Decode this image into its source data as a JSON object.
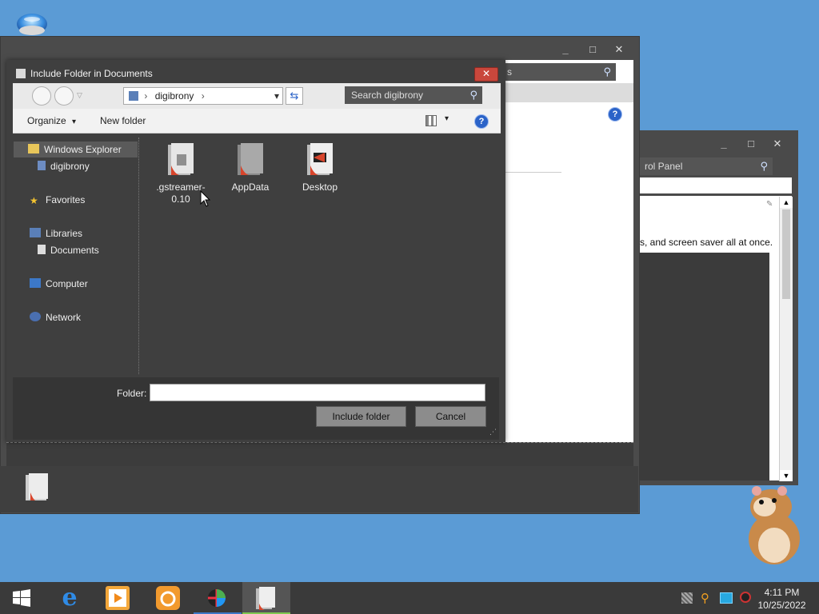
{
  "desktop": {
    "top_icon": "sphere-orb-icon"
  },
  "back_window": {
    "search_partial": "rol Panel",
    "description_partial": "s, and screen saver all at once.",
    "controls": [
      "_",
      "□",
      "✕"
    ]
  },
  "main_window": {
    "search_partial": "s",
    "controls": [
      "_",
      "□",
      "✕"
    ]
  },
  "dialog": {
    "title": "Include Folder in Documents",
    "close": "✕",
    "address": {
      "crumb": "digibrony",
      "sep": "›",
      "drop": "▾"
    },
    "search_placeholder": "Search digibrony",
    "toolbar": {
      "organize": "Organize",
      "organize_arrow": "▾",
      "new_folder": "New folder",
      "view_arrow": "▾",
      "help": "?"
    },
    "nav": {
      "windows_explorer": "Windows Explorer",
      "digibrony": "digibrony",
      "favorites": "Favorites",
      "libraries": "Libraries",
      "documents": "Documents",
      "computer": "Computer",
      "network": "Network"
    },
    "files": [
      {
        "name_line1": ".gstreamer-",
        "name_line2": "0.10"
      },
      {
        "name_line1": "AppData",
        "name_line2": ""
      },
      {
        "name_line1": "Desktop",
        "name_line2": ""
      }
    ],
    "folder_label": "Folder:",
    "folder_value": "",
    "include_button": "Include folder",
    "cancel_button": "Cancel"
  },
  "taskbar": {
    "apps": [
      "windows-start-icon",
      "internet-explorer-icon",
      "media-player-icon",
      "uc-browser-icon",
      "media-center-icon",
      "explorer-folder-icon"
    ],
    "time": "4:11 PM",
    "date": "10/25/2022"
  },
  "colors": {
    "desktop": "#5b9bd5",
    "window": "#4b4b4b",
    "close_red": "#c9473c",
    "accent_blue": "#2b63c8"
  }
}
